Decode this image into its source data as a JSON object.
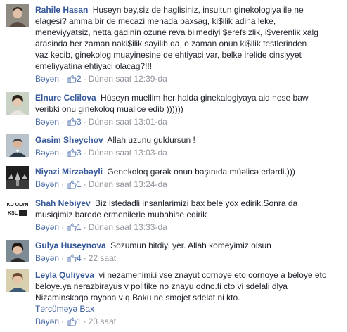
{
  "comments": [
    {
      "author": "Rahile Hasan",
      "lines": [
        "Huseyn bey,siz de haglisiniz, insultun ginekologiya ile ne",
        "elagesi? amma bir de mecazi menada baxsag, ki$ilik adina leke,",
        "meneviyyatsiz, hetta gadinin ozune reva bilmediyi $erefsizlik, i$verenlik xalg",
        "arasinda her zaman naki$ilik sayilib da, o zaman onun ki$ilik testlerinden",
        "vaz kecib, ginekolog muayinesine de ehtiyaci var, belke irelide cinsiyyet",
        "emeliyyatina ehtiyaci olacag?!!!"
      ],
      "like_label": "Bəyən",
      "likes": "2",
      "time": "Dünən saat 12:39-da",
      "avatar": "woman-portrait"
    },
    {
      "author": "Elnure Celilova",
      "lines": [
        "Hüseyn muellim her halda ginekalogiyaya aid nese baw",
        "veribki onu ginekoloq mualice edib ))))))"
      ],
      "like_label": "Bəyən",
      "likes": "3",
      "time": "Dünən saat 13:01-da",
      "avatar": "woman-portrait"
    },
    {
      "author": "Gasim Sheychov",
      "lines": [
        "Allah uzunu guldursun !"
      ],
      "like_label": "Bəyən",
      "likes": "3",
      "time": "Dünən saat 13:03-da",
      "avatar": "man-portrait"
    },
    {
      "author": "Niyazi Mirzəbəyli",
      "lines": [
        "Genekoloq gərək onun başınıda müəlicə edərdi.)))"
      ],
      "like_label": "Bəyən",
      "likes": "1",
      "time": "Dünən saat 13:24-da",
      "avatar": "dark-photo"
    },
    {
      "author": "Shah Nebiyev",
      "lines": [
        "Biz istedadli insanlarimizi bax bele yox edirik.Sonra da",
        "musiqimiz barede ermenilerle mubahise edirik"
      ],
      "like_label": "Bəyən",
      "likes": "1",
      "time": "Dünən saat 13:33-da",
      "avatar": "text-logo",
      "avatar_text": [
        "KU OLYN",
        "KSL"
      ]
    },
    {
      "author": "Gulya Huseynova",
      "lines": [
        "Sozumun bitdiyi yer. Allah komeyimiz olsun"
      ],
      "like_label": "Bəyən",
      "likes": "4",
      "time": "22 saat",
      "avatar": "woman-portrait"
    },
    {
      "author": "Leyla Quliyeva",
      "lines": [
        "vi nezamenimi.i vse znayut cornoye eto cornoye a beloye eto",
        "beloye.ya nerazbirayus v politike no znayu odno.ti cto vi sdelali dlya",
        "Nizaminskoqo rayona v q.Baku ne smojet sdelat ni kto."
      ],
      "translate_label": "Tərcüməyə Bax",
      "like_label": "Bəyən",
      "likes": "1",
      "time": "23 saat",
      "avatar": "woman-portrait"
    }
  ],
  "colors": {
    "link": "#365899",
    "meta": "#90949c",
    "text": "#1d2129"
  }
}
